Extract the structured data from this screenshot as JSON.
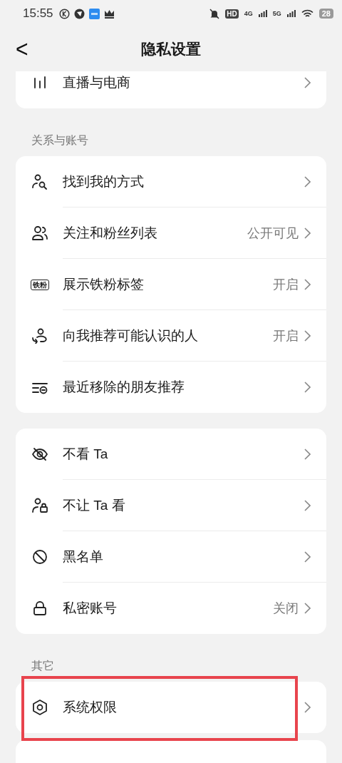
{
  "status_bar": {
    "time": "15:55",
    "hd": "HD",
    "network_1": "4G",
    "network_2": "5G",
    "battery": "28"
  },
  "header": {
    "back": "<",
    "title": "隐私设置"
  },
  "sections": [
    {
      "items": [
        {
          "label": "直播与电商",
          "highlighted": false
        }
      ]
    },
    {
      "label": "关系与账号",
      "items": [
        {
          "label": "找到我的方式",
          "highlighted": false
        },
        {
          "label": "关注和粉丝列表",
          "value": "公开可见",
          "highlighted": false
        },
        {
          "label": "展示铁粉标签",
          "value": "开启",
          "badge": "铁粉",
          "highlighted": false
        },
        {
          "label": "向我推荐可能认识的人",
          "value": "开启",
          "highlighted": false
        },
        {
          "label": "最近移除的朋友推荐",
          "highlighted": false
        }
      ]
    },
    {
      "items": [
        {
          "label": "不看 Ta",
          "highlighted": false
        },
        {
          "label": "不让 Ta 看",
          "highlighted": false
        },
        {
          "label": "黑名单",
          "highlighted": false
        },
        {
          "label": "私密账号",
          "value": "关闭",
          "highlighted": false
        }
      ]
    },
    {
      "label": "其它",
      "items": [
        {
          "label": "系统权限",
          "highlighted": true
        }
      ]
    }
  ]
}
